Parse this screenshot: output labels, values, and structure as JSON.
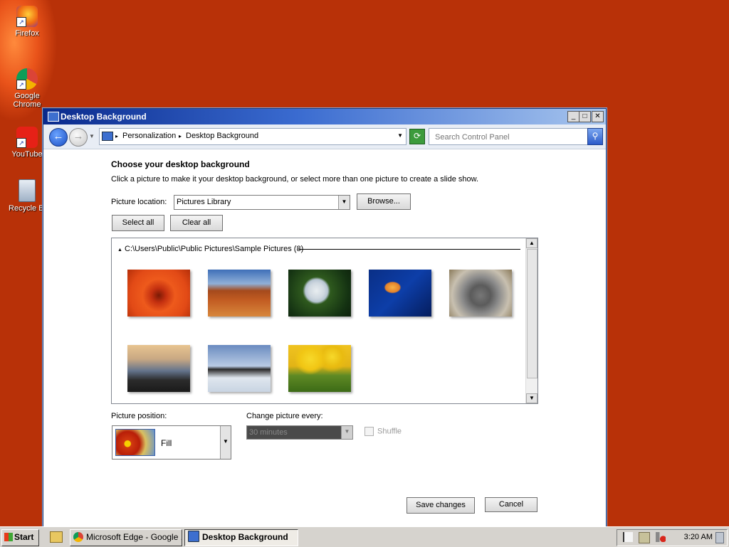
{
  "desktop": {
    "icons": [
      {
        "label": "Firefox"
      },
      {
        "label": "Google Chrome"
      },
      {
        "label": "YouTube"
      },
      {
        "label": "Recycle Bi"
      }
    ]
  },
  "window": {
    "title": "Desktop Background",
    "address": {
      "crumb1": "Personalization",
      "crumb2": "Desktop Background",
      "search_placeholder": "Search Control Panel"
    },
    "heading": "Choose your desktop background",
    "subheading": "Click a picture to make it your desktop background, or select more than one picture to create a slide show.",
    "picture_location_label": "Picture location:",
    "picture_location_value": "Pictures Library",
    "browse_label": "Browse...",
    "select_all_label": "Select all",
    "clear_all_label": "Clear all",
    "gallery": {
      "group_header": "C:\\Users\\Public\\Public Pictures\\Sample Pictures (8)",
      "thumbnails": [
        {
          "name": "chrysanthemum-thumbnail"
        },
        {
          "name": "desert-thumbnail"
        },
        {
          "name": "hydrangeas-thumbnail"
        },
        {
          "name": "jellyfish-thumbnail"
        },
        {
          "name": "koala-thumbnail"
        },
        {
          "name": "lighthouse-thumbnail"
        },
        {
          "name": "penguins-thumbnail"
        },
        {
          "name": "tulips-thumbnail"
        }
      ]
    },
    "picture_position_label": "Picture position:",
    "picture_position_value": "Fill",
    "change_picture_label": "Change picture every:",
    "change_picture_value": "30 minutes",
    "shuffle_label": "Shuffle",
    "save_label": "Save changes",
    "cancel_label": "Cancel"
  },
  "taskbar": {
    "start_label": "Start",
    "tasks": [
      {
        "label": "Microsoft Edge - Google ..."
      },
      {
        "label": "Desktop Background"
      }
    ],
    "clock": "3:20 AM"
  }
}
